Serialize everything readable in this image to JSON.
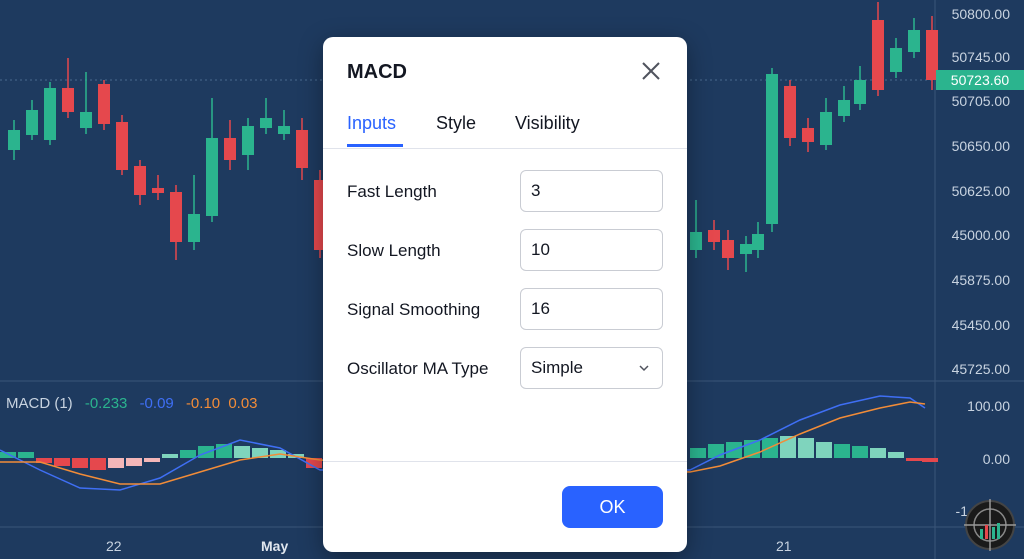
{
  "price_axis": [
    "50800.00",
    "50745.00",
    "50705.00",
    "50650.00",
    "50625.00",
    "45000.00",
    "45875.00",
    "45450.00",
    "45725.00"
  ],
  "current_price": "50723.60",
  "macd_axis": [
    "100.00",
    "0.00",
    "-1"
  ],
  "dates": [
    "22",
    "May",
    "21"
  ],
  "macd_legend": {
    "name": "MACD (1)",
    "v1": "-0.233",
    "v2": "-0.09",
    "v3": "-0.10",
    "v4": "0.03"
  },
  "colors": {
    "background": "#1e3a5f",
    "up": "#2bb48e",
    "down": "#e5484d",
    "macd_line": "#3f6ff5",
    "signal_line": "#f28c38",
    "accent": "#2962ff"
  },
  "dialog": {
    "title": "MACD",
    "tabs": [
      "Inputs",
      "Style",
      "Visibility"
    ],
    "active_tab": "Inputs",
    "fields": [
      {
        "label": "Fast Length",
        "value": "3"
      },
      {
        "label": "Slow Length",
        "value": "10"
      },
      {
        "label": "Signal Smoothing",
        "value": "16"
      }
    ],
    "ma_type": {
      "label": "Oscillator MA Type",
      "value": "Simple"
    },
    "ok_label": "OK"
  },
  "icons": {
    "close": "close-icon",
    "chevron": "chevron-down-icon",
    "logo": "crosshair-logo-icon"
  }
}
